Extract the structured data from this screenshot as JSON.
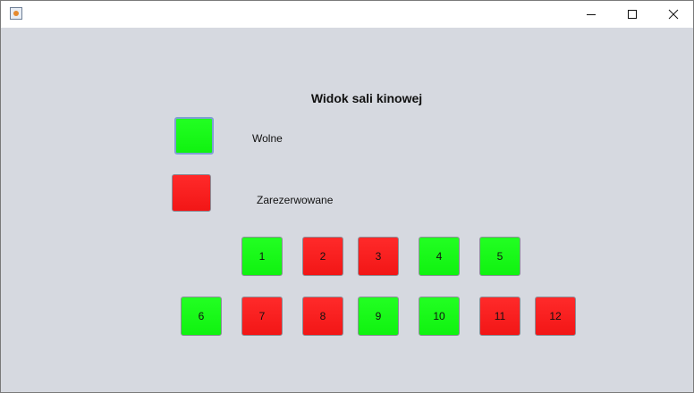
{
  "window": {
    "title": "",
    "colors": {
      "free": "#18fb18",
      "reserved": "#fb1c1c"
    }
  },
  "heading": "Widok sali kinowej",
  "legend": {
    "free_label": "Wolne",
    "reserved_label": "Zarezerwowane"
  },
  "seats": {
    "row1": [
      {
        "label": "1",
        "status": "free"
      },
      {
        "label": "2",
        "status": "reserved"
      },
      {
        "label": "3",
        "status": "reserved"
      },
      {
        "label": "4",
        "status": "free"
      },
      {
        "label": "5",
        "status": "free"
      }
    ],
    "row2": [
      {
        "label": "6",
        "status": "free"
      },
      {
        "label": "7",
        "status": "reserved"
      },
      {
        "label": "8",
        "status": "reserved"
      },
      {
        "label": "9",
        "status": "free"
      },
      {
        "label": "10",
        "status": "free"
      },
      {
        "label": "11",
        "status": "reserved"
      },
      {
        "label": "12",
        "status": "reserved"
      }
    ]
  }
}
